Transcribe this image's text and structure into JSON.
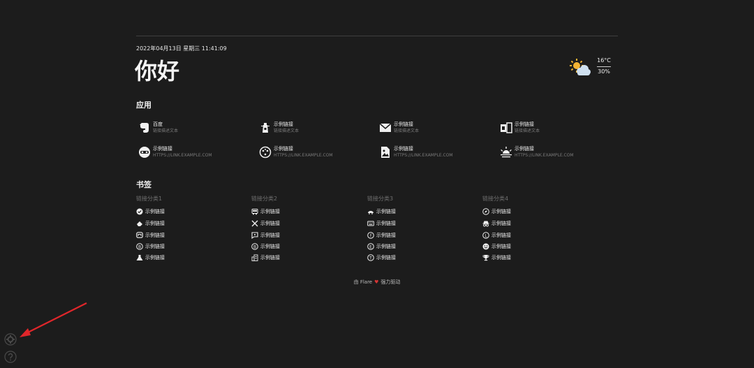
{
  "header": {
    "datetime": "2022年04月13日 星期三 11:41:09",
    "greeting": "你好"
  },
  "weather": {
    "icon": "partly-cloudy-icon",
    "temperature": "16°C",
    "humidity": "30%"
  },
  "apps": {
    "title": "应用",
    "items": [
      {
        "icon": "evernote-icon",
        "name": "百度",
        "desc": "链接描述文本"
      },
      {
        "icon": "lighthouse-icon",
        "name": "示例链接",
        "desc": "链接描述文本"
      },
      {
        "icon": "mail-icon",
        "name": "示例链接",
        "desc": "链接描述文本"
      },
      {
        "icon": "office-icon",
        "name": "示例链接",
        "desc": "链接描述文本"
      },
      {
        "icon": "mask-icon",
        "name": "示例链接",
        "desc": "HTTPS://LINK.EXAMPLE.COM"
      },
      {
        "icon": "palette-icon",
        "name": "示例链接",
        "desc": "HTTPS://LINK.EXAMPLE.COM"
      },
      {
        "icon": "image-file-icon",
        "name": "示例链接",
        "desc": "HTTPS://LINK.EXAMPLE.COM"
      },
      {
        "icon": "sunset-icon",
        "name": "示例链接",
        "desc": "HTTPS://LINK.EXAMPLE.COM"
      }
    ]
  },
  "bookmarks": {
    "title": "书签",
    "categories": [
      {
        "name": "链接分类1",
        "links": [
          {
            "icon": "check-badge-icon",
            "label": "示例链接"
          },
          {
            "icon": "eraser-icon",
            "label": "示例链接"
          },
          {
            "icon": "mastodon-icon",
            "label": "示例链接"
          },
          {
            "icon": "bitcoin-icon",
            "label": "示例链接"
          },
          {
            "icon": "flask-icon",
            "label": "示例链接"
          }
        ]
      },
      {
        "name": "链接分类2",
        "links": [
          {
            "icon": "bus-icon",
            "label": "示例链接"
          },
          {
            "icon": "tools-cross-icon",
            "label": "示例链接"
          },
          {
            "icon": "message-icon",
            "label": "示例链接"
          },
          {
            "icon": "bitcoin-circle-icon",
            "label": "示例链接"
          },
          {
            "icon": "building-icon",
            "label": "示例链接"
          }
        ]
      },
      {
        "name": "链接分类3",
        "links": [
          {
            "icon": "cloud-car-icon",
            "label": "示例链接"
          },
          {
            "icon": "keyboard-icon",
            "label": "示例链接"
          },
          {
            "icon": "facebook-circle-icon",
            "label": "示例链接"
          },
          {
            "icon": "euro-circle-icon",
            "label": "示例链接"
          },
          {
            "icon": "tumblr-circle-icon",
            "label": "示例链接"
          }
        ]
      },
      {
        "name": "链接分类4",
        "links": [
          {
            "icon": "compass-icon",
            "label": "示例链接"
          },
          {
            "icon": "spy-icon",
            "label": "示例链接"
          },
          {
            "icon": "litecoin-icon",
            "label": "示例链接"
          },
          {
            "icon": "smile-icon",
            "label": "示例链接"
          },
          {
            "icon": "trophy-icon",
            "label": "示例链接"
          }
        ]
      }
    ]
  },
  "footer": {
    "prefix": "由 Flare",
    "suffix": "强力驱动"
  },
  "colors": {
    "background": "#1c1c1c",
    "text": "#eeeeee",
    "muted": "#7a7a7a",
    "heart": "#d63535",
    "annotation": "#e0262a"
  }
}
